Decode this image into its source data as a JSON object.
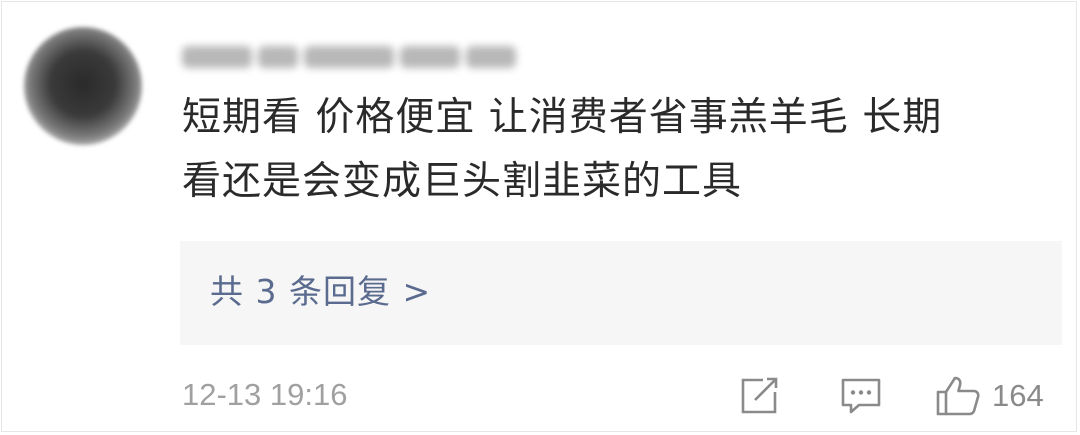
{
  "comment": {
    "line1": "短期看 价格便宜 让消费者省事羔羊毛 长期",
    "line2": "看还是会变成巨头割韭菜的工具"
  },
  "replies": {
    "label": "共 3 条回复 >"
  },
  "meta": {
    "timestamp": "12-13 19:16",
    "like_count": "164"
  },
  "icons": {
    "share": "edit-share-icon",
    "reply": "comment-icon",
    "like": "thumbs-up-icon"
  },
  "colors": {
    "link": "#5b6b8f",
    "reply_box_bg": "#f6f6f6",
    "meta_text": "#a0a0a0",
    "icon": "#8a8a8a"
  }
}
